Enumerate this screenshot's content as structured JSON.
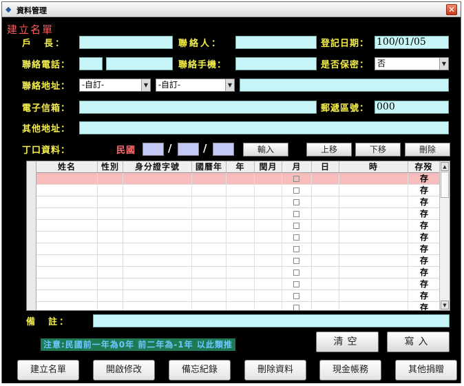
{
  "window": {
    "title": "資料管理",
    "close_glyph": "✕"
  },
  "section_title": "建立名單",
  "form": {
    "household_head_label": "戶　長：",
    "household_head_value": "",
    "contact_person_label": "聯絡人：",
    "contact_person_value": "",
    "reg_date_label": "登記日期：",
    "reg_date_value": "100/01/05",
    "phone_label": "聯絡電話：",
    "phone_area_value": "",
    "phone_number_value": "",
    "mobile_label": "聯絡手機：",
    "mobile_value": "",
    "confidential_label": "是否保密：",
    "confidential_value": "否",
    "address_label": "聯絡地址：",
    "address_city_value": "-自訂-",
    "address_district_value": "-自訂-",
    "address_value": "",
    "email_label": "電子信箱：",
    "email_value": "",
    "zip_label": "郵遞區號：",
    "zip_value": "000",
    "other_address_label": "其他地址：",
    "other_address_value": "",
    "member_label": "丁口資料：",
    "roc_label": "民國",
    "date_sep": "/",
    "remark_label": "備　註：",
    "remark_value": ""
  },
  "buttons": {
    "input": "輸入",
    "move_up": "上移",
    "move_down": "下移",
    "delete": "刪除",
    "clear": "清空",
    "write": "寫入"
  },
  "grid": {
    "columns": [
      "姓名",
      "性別",
      "身分證字號",
      "國曆年",
      "年",
      "閏月",
      "月",
      "日",
      "時",
      "存歿"
    ],
    "status_value": "存",
    "row_count": 12
  },
  "note": "注意:民國前一年為0年 前二年為-1年 以此類推",
  "bottom_buttons": [
    "建立名單",
    "開啟修改",
    "備忘紀錄",
    "刪除資料",
    "現金帳務",
    "其他捐贈"
  ],
  "colors": {
    "field": "#c8f6f8",
    "label": "#f5ef4e",
    "title": "#ff5a5a",
    "selected_row": "#f7bcbc"
  }
}
